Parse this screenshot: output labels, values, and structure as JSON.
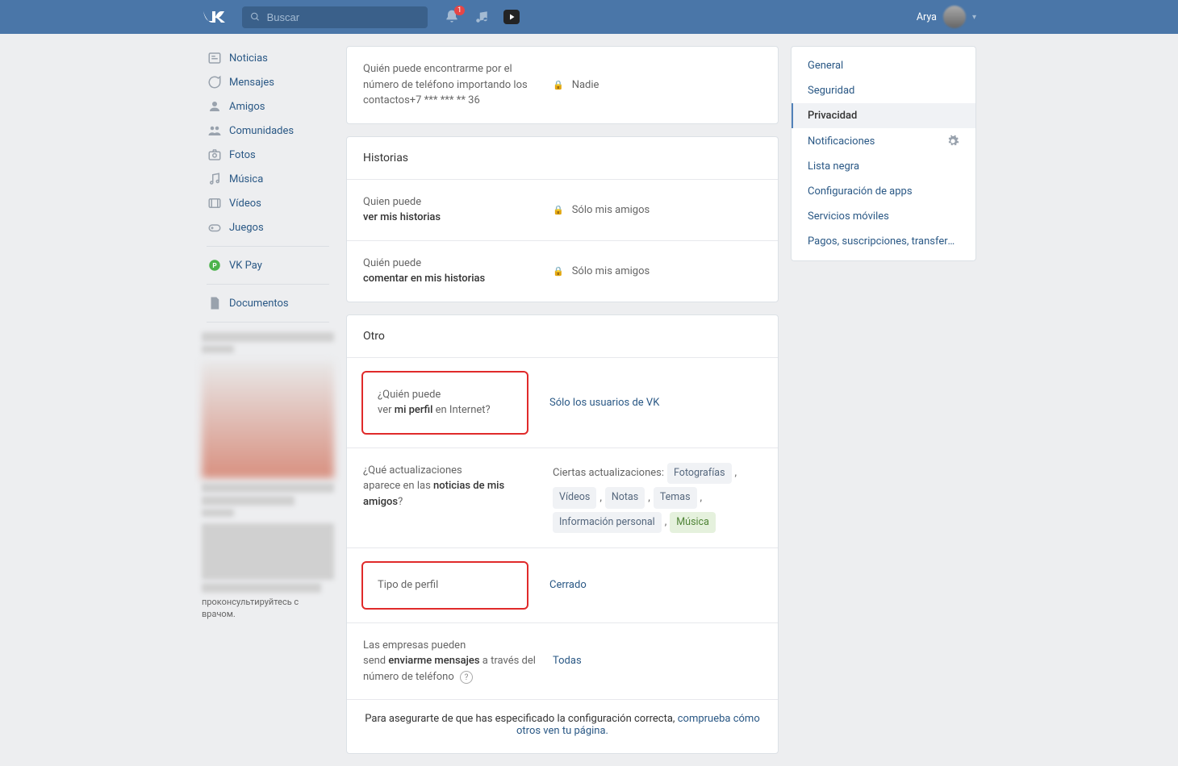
{
  "header": {
    "search_placeholder": "Buscar",
    "notification_badge": "1",
    "user_name": "Arya"
  },
  "sidebar": {
    "items": [
      {
        "label": "Noticias",
        "icon": "news"
      },
      {
        "label": "Mensajes",
        "icon": "msg"
      },
      {
        "label": "Amigos",
        "icon": "friends"
      },
      {
        "label": "Comunidades",
        "icon": "groups"
      },
      {
        "label": "Fotos",
        "icon": "photos"
      },
      {
        "label": "Música",
        "icon": "music"
      },
      {
        "label": "Vídeos",
        "icon": "video"
      },
      {
        "label": "Juegos",
        "icon": "games"
      }
    ],
    "pay_label": "VK Pay",
    "docs_label": "Documentos",
    "ad_footer": "проконсультируйтесь с врачом."
  },
  "privacy_top": {
    "label": "Quién puede encontrarme por el número de teléfono importando los contactos+7 *** *** ** 36",
    "value": "Nadie"
  },
  "stories": {
    "header": "Historias",
    "rows": [
      {
        "label_pre": "Quien puede",
        "label_bold": "ver mis historias",
        "value": "Sólo mis amigos"
      },
      {
        "label_pre": "Quién puede",
        "label_bold": "comentar en mis historias",
        "value": "Sólo mis amigos"
      }
    ]
  },
  "other": {
    "header": "Otro",
    "profile_view": {
      "line1": "¿Quién puede",
      "line2_pre": "ver ",
      "line2_bold": "mi perfil",
      "line2_post": " en Internet?",
      "value": "Sólo los usuarios de VK"
    },
    "updates": {
      "line1": "¿Qué actualizaciones",
      "line2_pre": "aparece en las ",
      "line2_bold": "noticias de mis amigos",
      "line2_post": "?",
      "prefix": "Ciertas actualizaciones:",
      "tags": [
        "Fotografías",
        "Vídeos",
        "Notas",
        "Temas",
        "Información personal",
        "Música"
      ]
    },
    "profile_type": {
      "label": "Tipo de perfil",
      "value": "Cerrado"
    },
    "companies": {
      "line1": "Las empresas pueden",
      "line2_pre": "send ",
      "line2_bold": "enviarme mensajes",
      "line2_post": " a través del número de teléfono",
      "value": "Todas"
    },
    "footer_pre": "Para asegurarte de que has especificado la configuración correcta, ",
    "footer_link": "comprueba cómo otros ven tu página."
  },
  "right_nav": {
    "items": [
      {
        "label": "General"
      },
      {
        "label": "Seguridad"
      },
      {
        "label": "Privacidad",
        "active": true
      },
      {
        "label": "Notificaciones",
        "gear": true
      },
      {
        "label": "Lista negra"
      },
      {
        "label": "Configuración de apps"
      },
      {
        "label": "Servicios móviles"
      },
      {
        "label": "Pagos, suscripciones, transferenc…"
      }
    ]
  }
}
